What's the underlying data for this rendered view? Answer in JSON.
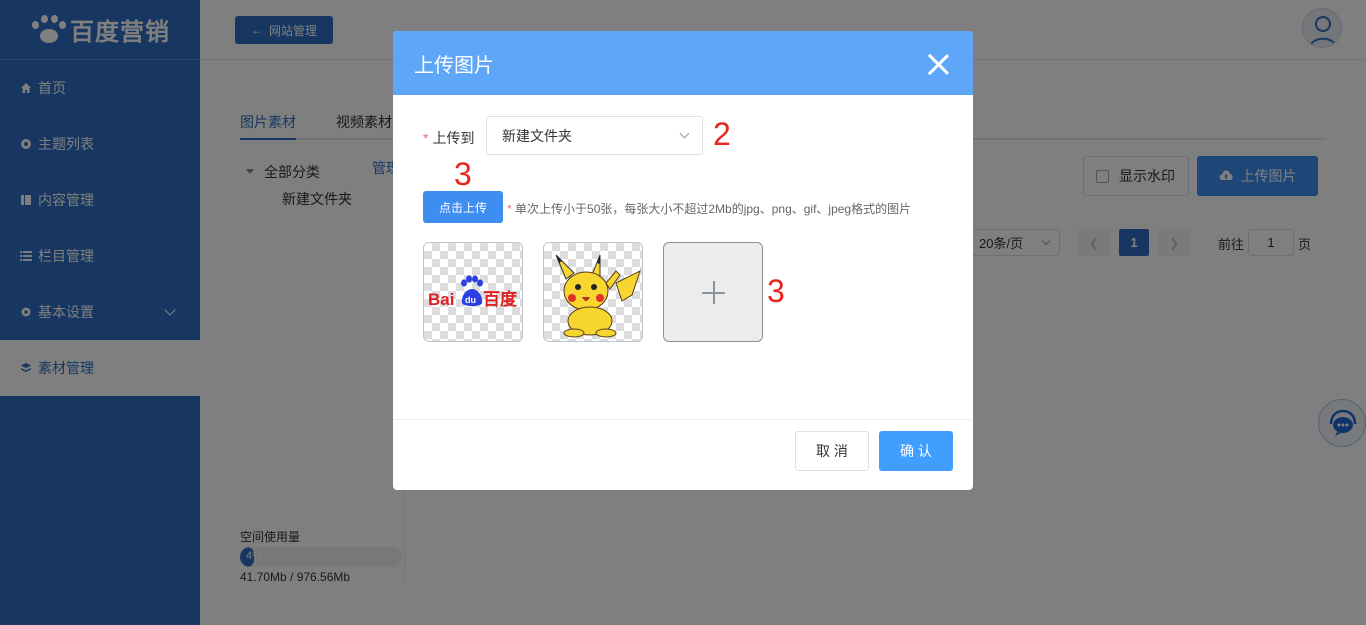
{
  "app": {
    "logo_text": "百度营销"
  },
  "sidebar": {
    "items": [
      {
        "label": "首页",
        "icon": "home-icon"
      },
      {
        "label": "主题列表",
        "icon": "theme-icon"
      },
      {
        "label": "内容管理",
        "icon": "content-icon"
      },
      {
        "label": "栏目管理",
        "icon": "list-icon"
      },
      {
        "label": "基本设置",
        "icon": "gear-icon"
      },
      {
        "label": "素材管理",
        "icon": "layers-icon"
      }
    ],
    "active": "素材管理"
  },
  "header": {
    "back_label": "网站管理"
  },
  "main": {
    "tabs": [
      "图片素材",
      "视频素材"
    ],
    "tree": {
      "root": "全部分类",
      "manage_link": "管理",
      "child": "新建文件夹"
    },
    "watermark_label": "显示水印",
    "upload_label": "上传图片",
    "pager": {
      "page_size": "20条/页",
      "current_page": "1",
      "goto_prefix": "前往",
      "goto_value": "1",
      "goto_suffix": "页"
    },
    "storage": {
      "label": "空间使用量",
      "percent": "4%",
      "fraction": 0.043,
      "value": "41.70Mb / 976.56Mb"
    }
  },
  "modal": {
    "title": "上传图片",
    "upload_to_label": "上传到",
    "folder_value": "新建文件夹",
    "click_upload_label": "点击上传",
    "hint": "单次上传小于50张，每张大小不超过2Mb的jpg、png、gif、jpeg格式的图片",
    "annotations": [
      "2",
      "3",
      "3"
    ],
    "images": [
      {
        "name": "baidu-logo-image",
        "logo_text": "Bai百度"
      },
      {
        "name": "pikachu-image"
      }
    ],
    "cancel_label": "取 消",
    "ok_label": "确 认"
  },
  "colors": {
    "sidebar_blue": "#2f6fc4",
    "modal_header_blue": "#5ea6f7",
    "primary_button": "#409eff",
    "annotation_red": "#e8241e"
  }
}
